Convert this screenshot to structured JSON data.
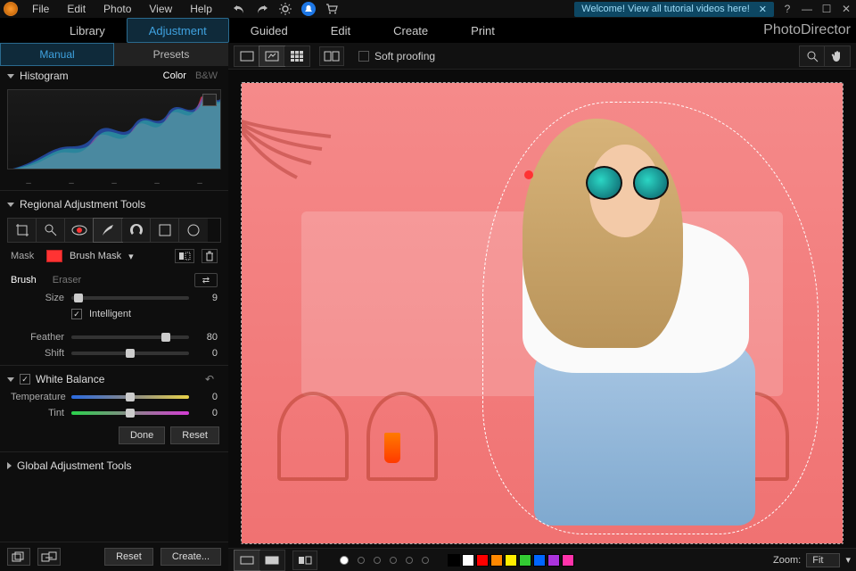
{
  "menu": {
    "file": "File",
    "edit": "Edit",
    "photo": "Photo",
    "view": "View",
    "help": "Help"
  },
  "titlebar": {
    "tutorial": "Welcome! View all tutorial videos here!"
  },
  "brand": "PhotoDirector",
  "modules": {
    "library": "Library",
    "adjustment": "Adjustment",
    "guided": "Guided",
    "edit": "Edit",
    "create": "Create",
    "print": "Print"
  },
  "subtabs": {
    "manual": "Manual",
    "presets": "Presets"
  },
  "histogram": {
    "title": "Histogram",
    "color": "Color",
    "bw": "B&W"
  },
  "regional": {
    "title": "Regional Adjustment Tools",
    "mask_label": "Mask",
    "mask_name": "Brush Mask",
    "brush": "Brush",
    "eraser": "Eraser",
    "size_label": "Size",
    "size_val": "9",
    "intelligent": "Intelligent",
    "feather_label": "Feather",
    "feather_val": "80",
    "shift_label": "Shift",
    "shift_val": "0"
  },
  "wb": {
    "title": "White Balance",
    "temp": "Temperature",
    "temp_val": "0",
    "tint": "Tint",
    "tint_val": "0"
  },
  "actions": {
    "done": "Done",
    "reset": "Reset",
    "create": "Create..."
  },
  "global": {
    "title": "Global Adjustment Tools"
  },
  "viewer": {
    "soft": "Soft proofing",
    "zoom_label": "Zoom:",
    "zoom_val": "Fit"
  },
  "swatches": [
    "#000000",
    "#ffffff",
    "#ff0000",
    "#ff8800",
    "#ffee00",
    "#33cc33",
    "#0066ff",
    "#aa33dd",
    "#ff33aa"
  ]
}
